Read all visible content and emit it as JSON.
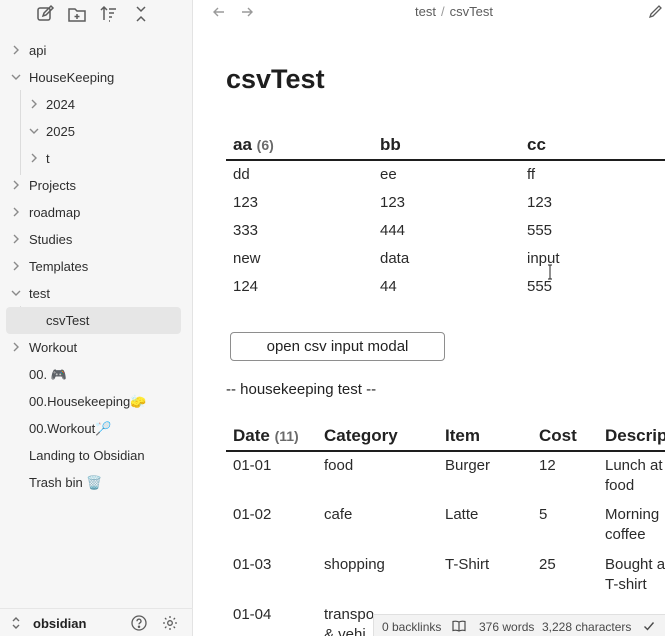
{
  "sidebar": {
    "tree": [
      {
        "label": "api",
        "chevron": "right"
      },
      {
        "label": "HouseKeeping",
        "chevron": "down"
      },
      {
        "label": "2024",
        "chevron": "right",
        "indent": 1
      },
      {
        "label": "2025",
        "chevron": "down",
        "indent": 1
      },
      {
        "label": "t",
        "chevron": "right",
        "indent": 1
      },
      {
        "label": "Projects",
        "chevron": "right"
      },
      {
        "label": "roadmap",
        "chevron": "right"
      },
      {
        "label": "Studies",
        "chevron": "right"
      },
      {
        "label": "Templates",
        "chevron": "right"
      },
      {
        "label": "test",
        "chevron": "down"
      },
      {
        "label": "csvTest",
        "active": true,
        "indent": 1
      },
      {
        "label": "Workout",
        "chevron": "right"
      },
      {
        "label": "00. 🎮"
      },
      {
        "label": "00.Housekeeping🧽"
      },
      {
        "label": "00.Workout🏸"
      },
      {
        "label": "Landing to Obsidian"
      },
      {
        "label": "Trash bin 🗑️"
      }
    ],
    "vault_name": "obsidian"
  },
  "breadcrumb": {
    "parent": "test",
    "separator": "/",
    "current": "csvTest"
  },
  "note": {
    "title": "csvTest",
    "table1": {
      "headers": [
        "aa",
        "bb",
        "cc"
      ],
      "count": "(6)",
      "rows": [
        [
          "dd",
          "ee",
          "ff"
        ],
        [
          "123",
          "123",
          "123"
        ],
        [
          "333",
          "444",
          "555"
        ],
        [
          "new",
          "data",
          "input"
        ],
        [
          "124",
          "44",
          "555"
        ]
      ]
    },
    "button_label": "open csv input modal",
    "housekeeping_heading": "-- housekeeping test --",
    "table2": {
      "headers": [
        "Date",
        "Category",
        "Item",
        "Cost",
        "Descrip"
      ],
      "count": "(11)",
      "rows": [
        {
          "date": "01-01",
          "category": "food",
          "item": "Burger",
          "cost": "12",
          "desc1": "Lunch at",
          "desc2": "food"
        },
        {
          "date": "01-02",
          "category": "cafe",
          "item": "Latte",
          "cost": "5",
          "desc1": "Morning",
          "desc2": "coffee"
        },
        {
          "date": "01-03",
          "category": "shopping",
          "item": "T-Shirt",
          "cost": "25",
          "desc1": "Bought a",
          "desc2": "T-shirt"
        },
        {
          "date": "01-04",
          "category": "transpo",
          "category2": "& vehi",
          "item": "",
          "cost": "",
          "desc1": "",
          "desc2": ""
        }
      ]
    }
  },
  "status": {
    "backlinks": "0 backlinks",
    "words": "376 words",
    "characters": "3,228 characters"
  }
}
